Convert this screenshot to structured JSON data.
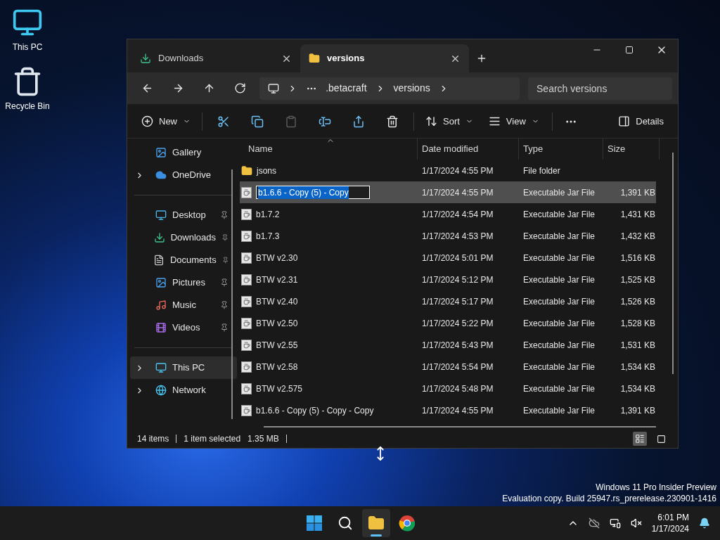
{
  "desktop_icons": [
    {
      "kind": "pc",
      "label": "This PC"
    },
    {
      "kind": "bin",
      "label": "Recycle Bin"
    }
  ],
  "tabs": [
    {
      "kind": "downloads",
      "label": "Downloads",
      "selected": false
    },
    {
      "kind": "folder",
      "label": "versions",
      "selected": true
    }
  ],
  "breadcrumbs": [
    ".betacraft",
    "versions"
  ],
  "search": {
    "placeholder": "Search versions"
  },
  "toolbar": {
    "new": "New",
    "icon_buttons": [
      {
        "kind": "cut",
        "disabled": false
      },
      {
        "kind": "copy",
        "disabled": false
      },
      {
        "kind": "paste",
        "disabled": true
      },
      {
        "kind": "rename",
        "disabled": false
      },
      {
        "kind": "share",
        "disabled": false
      },
      {
        "kind": "delete",
        "disabled": false
      }
    ],
    "sort": "Sort",
    "view": "View",
    "details": "Details"
  },
  "sidebar": [
    [
      {
        "kind": "gallery",
        "label": "Gallery",
        "expandable": false,
        "pinned": false,
        "selected": false
      },
      {
        "kind": "onedrive",
        "label": "OneDrive",
        "expandable": true,
        "pinned": false,
        "selected": false
      }
    ],
    [
      {
        "kind": "desktop",
        "label": "Desktop",
        "expandable": false,
        "pinned": true,
        "selected": false
      },
      {
        "kind": "downloads",
        "label": "Downloads",
        "expandable": false,
        "pinned": true,
        "selected": false
      },
      {
        "kind": "documents",
        "label": "Documents",
        "expandable": false,
        "pinned": true,
        "selected": false
      },
      {
        "kind": "pictures",
        "label": "Pictures",
        "expandable": false,
        "pinned": true,
        "selected": false
      },
      {
        "kind": "music",
        "label": "Music",
        "expandable": false,
        "pinned": true,
        "selected": false
      },
      {
        "kind": "videos",
        "label": "Videos",
        "expandable": false,
        "pinned": true,
        "selected": false
      }
    ],
    [
      {
        "kind": "pc",
        "label": "This PC",
        "expandable": true,
        "pinned": false,
        "selected": true
      },
      {
        "kind": "network",
        "label": "Network",
        "expandable": true,
        "pinned": false,
        "selected": false
      }
    ]
  ],
  "columns": [
    "Name",
    "Date modified",
    "Type",
    "Size"
  ],
  "files": [
    {
      "kind": "folder",
      "name": "jsons",
      "date": "1/17/2024 4:55 PM",
      "type": "File folder",
      "selected": false,
      "renaming": false
    },
    {
      "kind": "jar",
      "name": "b1.6.6 - Copy (5) - Copy",
      "date": "1/17/2024 4:55 PM",
      "type": "Executable Jar File",
      "size": "1,391 KB",
      "selected": true,
      "renaming": true
    },
    {
      "kind": "jar",
      "name": "b1.7.2",
      "date": "1/17/2024 4:54 PM",
      "type": "Executable Jar File",
      "size": "1,431 KB",
      "selected": false,
      "renaming": false
    },
    {
      "kind": "jar",
      "name": "b1.7.3",
      "date": "1/17/2024 4:53 PM",
      "type": "Executable Jar File",
      "size": "1,432 KB",
      "selected": false,
      "renaming": false
    },
    {
      "kind": "jar",
      "name": "BTW v2.30",
      "date": "1/17/2024 5:01 PM",
      "type": "Executable Jar File",
      "size": "1,516 KB",
      "selected": false,
      "renaming": false
    },
    {
      "kind": "jar",
      "name": "BTW v2.31",
      "date": "1/17/2024 5:12 PM",
      "type": "Executable Jar File",
      "size": "1,525 KB",
      "selected": false,
      "renaming": false
    },
    {
      "kind": "jar",
      "name": "BTW v2.40",
      "date": "1/17/2024 5:17 PM",
      "type": "Executable Jar File",
      "size": "1,526 KB",
      "selected": false,
      "renaming": false
    },
    {
      "kind": "jar",
      "name": "BTW v2.50",
      "date": "1/17/2024 5:22 PM",
      "type": "Executable Jar File",
      "size": "1,528 KB",
      "selected": false,
      "renaming": false
    },
    {
      "kind": "jar",
      "name": "BTW v2.55",
      "date": "1/17/2024 5:43 PM",
      "type": "Executable Jar File",
      "size": "1,531 KB",
      "selected": false,
      "renaming": false
    },
    {
      "kind": "jar",
      "name": "BTW v2.58",
      "date": "1/17/2024 5:54 PM",
      "type": "Executable Jar File",
      "size": "1,534 KB",
      "selected": false,
      "renaming": false
    },
    {
      "kind": "jar",
      "name": "BTW v2.575",
      "date": "1/17/2024 5:48 PM",
      "type": "Executable Jar File",
      "size": "1,534 KB",
      "selected": false,
      "renaming": false
    },
    {
      "kind": "jar",
      "name": "b1.6.6 - Copy (5) - Copy - Copy",
      "date": "1/17/2024 4:55 PM",
      "type": "Executable Jar File",
      "size": "1,391 KB",
      "selected": false,
      "renaming": false
    }
  ],
  "status_bar": {
    "count": "14 items",
    "selection": "1 item selected",
    "size": "1.35 MB",
    "views": [
      {
        "kind": "details",
        "selected": true
      },
      {
        "kind": "tiles",
        "selected": false
      }
    ]
  },
  "edition": [
    "Windows 11 Pro Insider Preview",
    "Evaluation copy. Build 25947.rs_prerelease.230901-1416"
  ],
  "taskbar": [
    {
      "kind": "start",
      "active": false
    },
    {
      "kind": "search",
      "active": false
    },
    {
      "kind": "explorer",
      "active": true
    },
    {
      "kind": "chrome",
      "active": false
    }
  ],
  "clock": {
    "time": "6:01 PM",
    "date": "1/17/2024"
  }
}
